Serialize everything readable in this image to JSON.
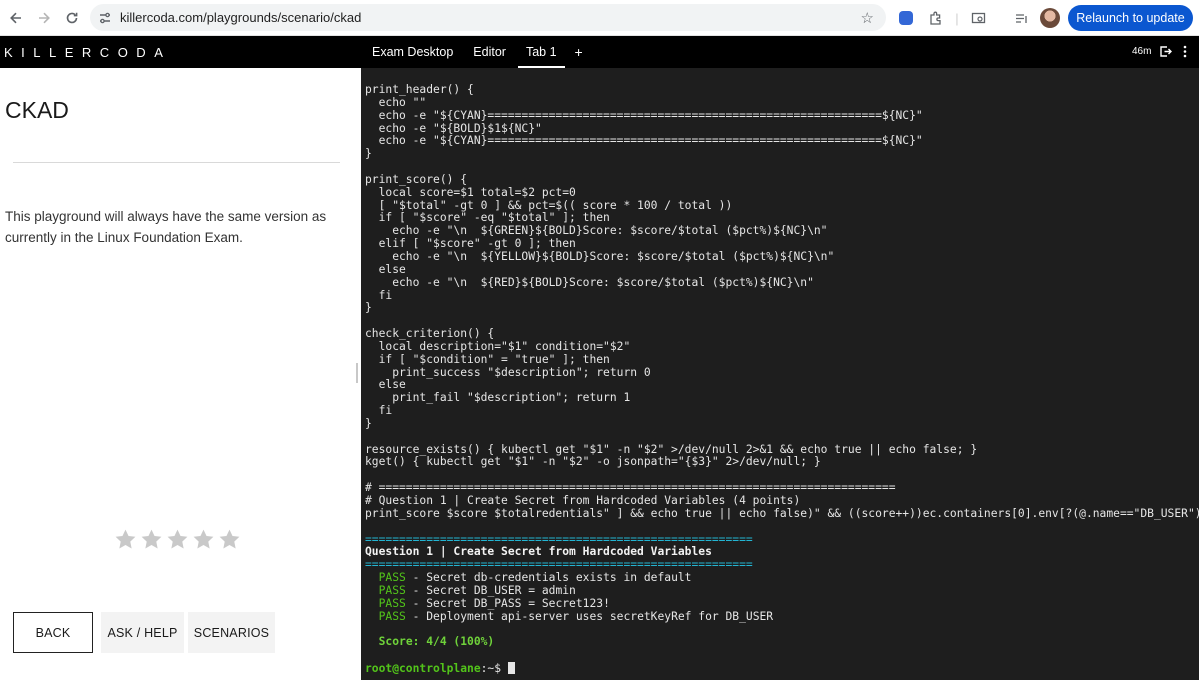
{
  "browser": {
    "url": "killercoda.com/playgrounds/scenario/ckad",
    "relaunch_label": "Relaunch to update"
  },
  "app": {
    "logo": "KILLERCODA",
    "tabs": [
      {
        "label": "Exam Desktop"
      },
      {
        "label": "Editor"
      },
      {
        "label": "Tab 1"
      }
    ],
    "add_tab": "+",
    "timer": "46m"
  },
  "sidebar": {
    "title": "CKAD",
    "description": "This playground will always have the same version as currently in the Linux Foundation Exam.",
    "rating": {
      "stars_total": 5,
      "stars_filled": 0
    },
    "buttons": {
      "back": "BACK",
      "help": "ASK / HELP",
      "scenarios": "SCENARIOS"
    }
  },
  "terminal": {
    "lines": [
      "print_header() {",
      "  echo \"\"",
      "  echo -e \"${CYAN}==========================================================${NC}\"",
      "  echo -e \"${BOLD}$1${NC}\"",
      "  echo -e \"${CYAN}==========================================================${NC}\"",
      "}",
      "",
      "print_score() {",
      "  local score=$1 total=$2 pct=0",
      "  [ \"$total\" -gt 0 ] && pct=$(( score * 100 / total ))",
      "  if [ \"$score\" -eq \"$total\" ]; then",
      "    echo -e \"\\n  ${GREEN}${BOLD}Score: $score/$total ($pct%)${NC}\\n\"",
      "  elif [ \"$score\" -gt 0 ]; then",
      "    echo -e \"\\n  ${YELLOW}${BOLD}Score: $score/$total ($pct%)${NC}\\n\"",
      "  else",
      "    echo -e \"\\n  ${RED}${BOLD}Score: $score/$total ($pct%)${NC}\\n\"",
      "  fi",
      "}",
      "",
      "check_criterion() {",
      "  local description=\"$1\" condition=\"$2\"",
      "  if [ \"$condition\" = \"true\" ]; then",
      "    print_success \"$description\"; return 0",
      "  else",
      "    print_fail \"$description\"; return 1",
      "  fi",
      "}",
      "",
      "resource_exists() { kubectl get \"$1\" -n \"$2\" >/dev/null 2>&1 && echo true || echo false; }",
      "kget() { kubectl get \"$1\" -n \"$2\" -o jsonpath=\"{$3}\" 2>/dev/null; }",
      "",
      "# ============================================================================",
      "# Question 1 | Create Secret from Hardcoded Variables (4 points)",
      "print_score $score $totalredentials\" ] && echo true || echo false)\" && ((score++))ec.containers[0].env[?(@.name==\"DB_USER\")].va",
      ""
    ],
    "rule": "=========================================================",
    "question_header": "Question 1 | Create Secret from Hardcoded Variables",
    "pass_label": "PASS",
    "results": [
      " - Secret db-credentials exists in default",
      " - Secret DB_USER = admin",
      " - Secret DB_PASS = Secret123!",
      " - Deployment api-server uses secretKeyRef for DB_USER"
    ],
    "score": "Score: 4/4 (100%)",
    "prompt": "root@controlplane",
    "prompt_suffix": ":~$ "
  },
  "colors": {
    "relaunch_bg": "#0b57d0",
    "terminal_bg": "#1e1e1e",
    "cyan": "#23b5d3",
    "green": "#52c41a"
  },
  "icons": {
    "back": "arrow-left-icon",
    "forward": "arrow-right-icon",
    "reload": "reload-icon",
    "site_settings": "tune-icon",
    "bookmark": "star-outline-icon",
    "star": "star-icon"
  }
}
